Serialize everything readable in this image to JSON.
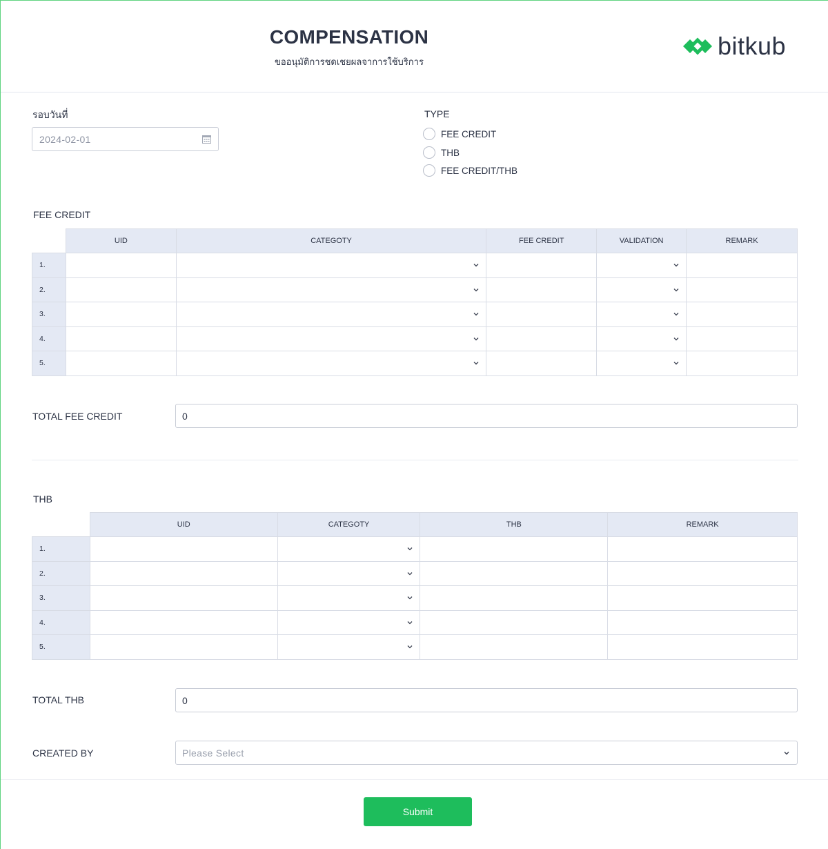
{
  "header": {
    "title": "COMPENSATION",
    "subtitle": "ขออนุมัติการชดเชยผลจาการใช้บริการ",
    "logo_text": "bitkub",
    "brand_color": "#1ebd5c"
  },
  "date_field": {
    "label": "รอบวันที่",
    "value": "2024-02-01",
    "icon": "calendar-icon"
  },
  "type_field": {
    "label": "TYPE",
    "options": [
      "FEE CREDIT",
      "THB",
      "FEE CREDIT/THB"
    ],
    "selected": null
  },
  "fee_credit_table": {
    "section_label": "FEE CREDIT",
    "columns": [
      "UID",
      "CATEGOTY",
      "FEE CREDIT",
      "VALIDATION",
      "REMARK"
    ],
    "rows": [
      "1.",
      "2.",
      "3.",
      "4.",
      "5."
    ]
  },
  "total_fee_credit": {
    "label": "TOTAL FEE CREDIT",
    "value": "0"
  },
  "thb_table": {
    "section_label": "THB",
    "columns": [
      "UID",
      "CATEGOTY",
      "THB",
      "REMARK"
    ],
    "rows": [
      "1.",
      "2.",
      "3.",
      "4.",
      "5."
    ]
  },
  "total_thb": {
    "label": "TOTAL THB",
    "value": "0"
  },
  "created_by": {
    "label": "CREATED BY",
    "placeholder": "Please Select"
  },
  "submit": {
    "label": "Submit"
  }
}
